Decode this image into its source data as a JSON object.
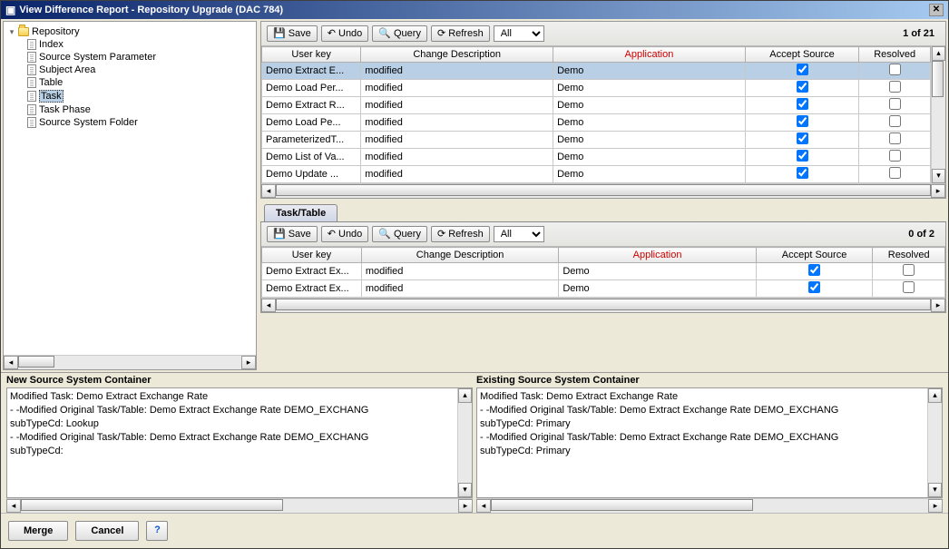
{
  "title": "View Difference Report - Repository Upgrade (DAC 784)",
  "tree": {
    "root": "Repository",
    "items": [
      "Index",
      "Source System Parameter",
      "Subject Area",
      "Table",
      "Task",
      "Task Phase",
      "Source System Folder"
    ],
    "selectedIndex": 4
  },
  "toolbar": {
    "save": "Save",
    "undo": "Undo",
    "query": "Query",
    "refresh": "Refresh",
    "filter": "All"
  },
  "columns": {
    "userKey": "User key",
    "changeDesc": "Change Description",
    "application": "Application",
    "acceptSource": "Accept Source",
    "resolved": "Resolved"
  },
  "topGrid": {
    "count": "1 of 21",
    "rows": [
      {
        "userKey": "Demo Extract E...",
        "changeDesc": "modified",
        "application": "Demo",
        "accept": true,
        "resolved": false,
        "selected": true
      },
      {
        "userKey": "Demo Load Per...",
        "changeDesc": "modified",
        "application": "Demo",
        "accept": true,
        "resolved": false
      },
      {
        "userKey": "Demo Extract R...",
        "changeDesc": "modified",
        "application": "Demo",
        "accept": true,
        "resolved": false
      },
      {
        "userKey": "Demo Load  Pe...",
        "changeDesc": "modified",
        "application": "Demo",
        "accept": true,
        "resolved": false
      },
      {
        "userKey": "ParameterizedT...",
        "changeDesc": "modified",
        "application": "Demo",
        "accept": true,
        "resolved": false
      },
      {
        "userKey": "Demo List of Va...",
        "changeDesc": "modified",
        "application": "Demo",
        "accept": true,
        "resolved": false
      },
      {
        "userKey": "Demo Update ...",
        "changeDesc": "modified",
        "application": "Demo",
        "accept": true,
        "resolved": false
      }
    ]
  },
  "subTab": {
    "label": "Task/Table"
  },
  "subGrid": {
    "count": "0 of 2",
    "rows": [
      {
        "userKey": "Demo Extract Ex...",
        "changeDesc": "modified",
        "application": "Demo",
        "accept": true,
        "resolved": false
      },
      {
        "userKey": "Demo Extract Ex...",
        "changeDesc": "modified",
        "application": "Demo",
        "accept": true,
        "resolved": false
      }
    ]
  },
  "newContainer": {
    "title": "New Source System Container",
    "lines": [
      "Modified Task: Demo Extract Exchange Rate",
      "- -Modified Original Task/Table: Demo Extract Exchange Rate DEMO_EXCHANG",
      "subTypeCd: Lookup",
      "- -Modified Original Task/Table: Demo Extract Exchange Rate DEMO_EXCHANG",
      "subTypeCd:"
    ]
  },
  "existingContainer": {
    "title": "Existing Source System Container",
    "lines": [
      "Modified Task: Demo Extract Exchange Rate",
      "- -Modified Original Task/Table: Demo Extract Exchange Rate DEMO_EXCHANG",
      "subTypeCd: Primary",
      "- -Modified Original Task/Table: Demo Extract Exchange Rate DEMO_EXCHANG",
      "subTypeCd: Primary"
    ]
  },
  "actions": {
    "merge": "Merge",
    "cancel": "Cancel"
  }
}
